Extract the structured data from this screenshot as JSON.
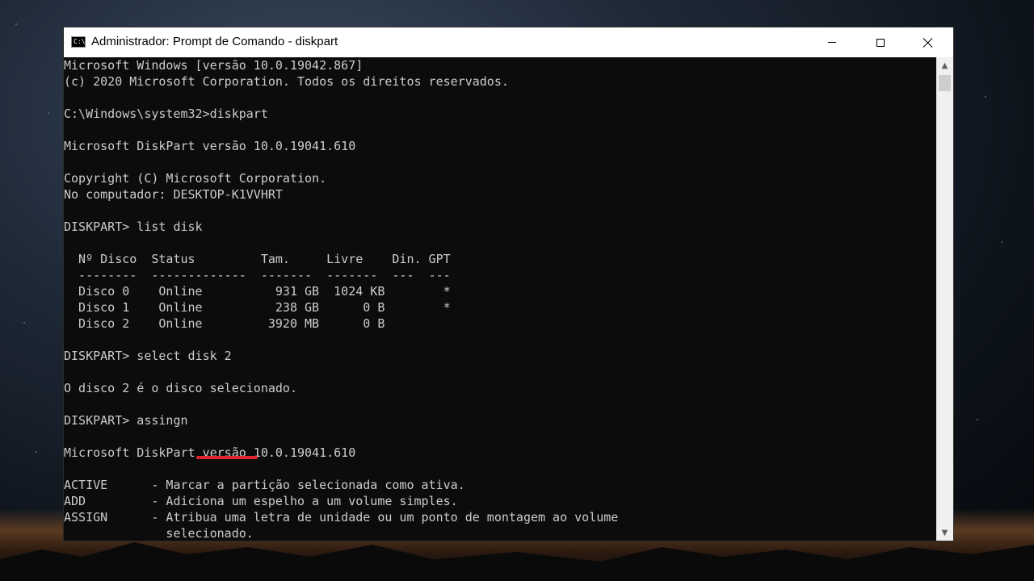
{
  "window": {
    "title": "Administrador: Prompt de Comando - diskpart",
    "icon": "cmd-icon",
    "icon_text": "C:\\",
    "controls": [
      "minimize-icon",
      "maximize-icon",
      "close-icon"
    ]
  },
  "console": {
    "lines": [
      "Microsoft Windows [versão 10.0.19042.867]",
      "(c) 2020 Microsoft Corporation. Todos os direitos reservados.",
      "",
      "C:\\Windows\\system32>diskpart",
      "",
      "Microsoft DiskPart versão 10.0.19041.610",
      "",
      "Copyright (C) Microsoft Corporation.",
      "No computador: DESKTOP-K1VVHRT",
      "",
      "DISKPART> list disk",
      "",
      "  Nº Disco  Status         Tam.     Livre    Din. GPT",
      "  --------  -------------  -------  -------  ---  ---",
      "  Disco 0    Online          931 GB  1024 KB        *",
      "  Disco 1    Online          238 GB      0 B        *",
      "  Disco 2    Online         3920 MB      0 B",
      "",
      "DISKPART> select disk 2",
      "",
      "O disco 2 é o disco selecionado.",
      "",
      "DISKPART> assingn",
      "",
      "Microsoft DiskPart versão 10.0.19041.610",
      "",
      "ACTIVE      - Marcar a partição selecionada como ativa.",
      "ADD         - Adiciona um espelho a um volume simples.",
      "ASSIGN      - Atribua uma letra de unidade ou um ponto de montagem ao volume",
      "              selecionado."
    ]
  },
  "annotation": {
    "underline_color": "#e0242b",
    "highlighted_command": "assingn"
  },
  "colors": {
    "console_bg": "#0c0c0c",
    "console_text": "#cccccc",
    "titlebar_bg": "#ffffff"
  }
}
